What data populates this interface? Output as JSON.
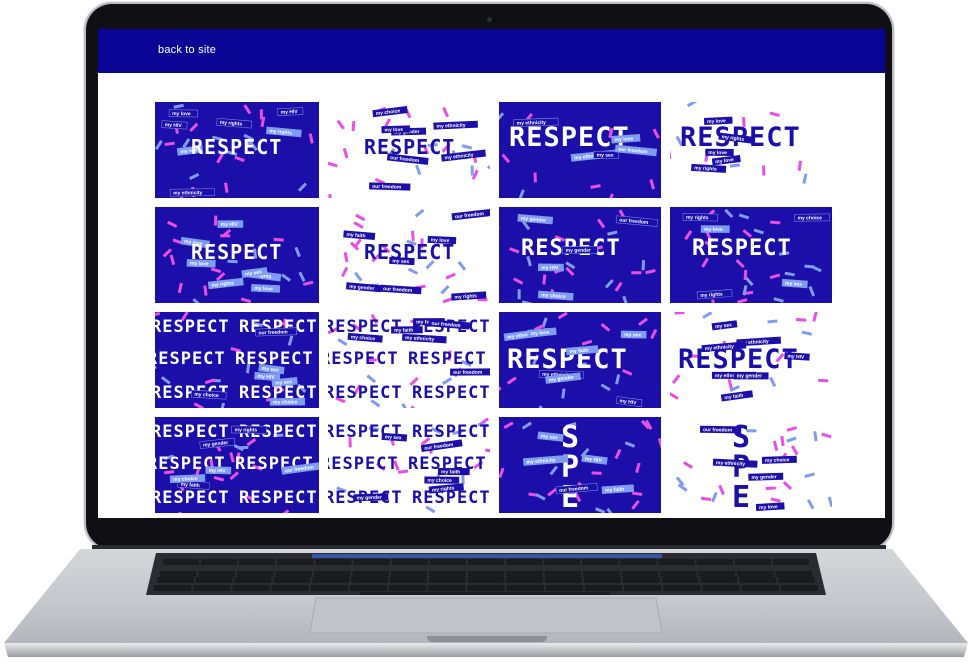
{
  "header": {
    "back_label": "back to site",
    "background": "#0b0596"
  },
  "gallery": {
    "title_word": "RESPECT",
    "label_texts": [
      "my love",
      "my gender",
      "my HIV",
      "my ethnicity",
      "my choice",
      "my rights",
      "our freedom",
      "my sex",
      "my faith"
    ],
    "colors": {
      "blue": "#1c0ea8",
      "pink": "#e94fe6",
      "light_blue": "#7f9cf0",
      "white": "#ffffff"
    },
    "tiles": [
      {
        "bg": "blue",
        "variant": "small-word"
      },
      {
        "bg": "white",
        "variant": "small-word"
      },
      {
        "bg": "blue",
        "variant": "big-word"
      },
      {
        "bg": "white",
        "variant": "big-word"
      },
      {
        "bg": "blue",
        "variant": "small-word"
      },
      {
        "bg": "white",
        "variant": "small-word"
      },
      {
        "bg": "blue",
        "variant": "medium-word"
      },
      {
        "bg": "blue",
        "variant": "medium-word"
      },
      {
        "bg": "blue",
        "variant": "repeat-word"
      },
      {
        "bg": "white",
        "variant": "repeat-word"
      },
      {
        "bg": "blue",
        "variant": "big-word-labels"
      },
      {
        "bg": "white",
        "variant": "big-word-labels"
      },
      {
        "bg": "blue",
        "variant": "repeat-word"
      },
      {
        "bg": "white",
        "variant": "repeat-word"
      },
      {
        "bg": "blue",
        "variant": "vertical-word"
      },
      {
        "bg": "white",
        "variant": "vertical-word"
      }
    ]
  }
}
